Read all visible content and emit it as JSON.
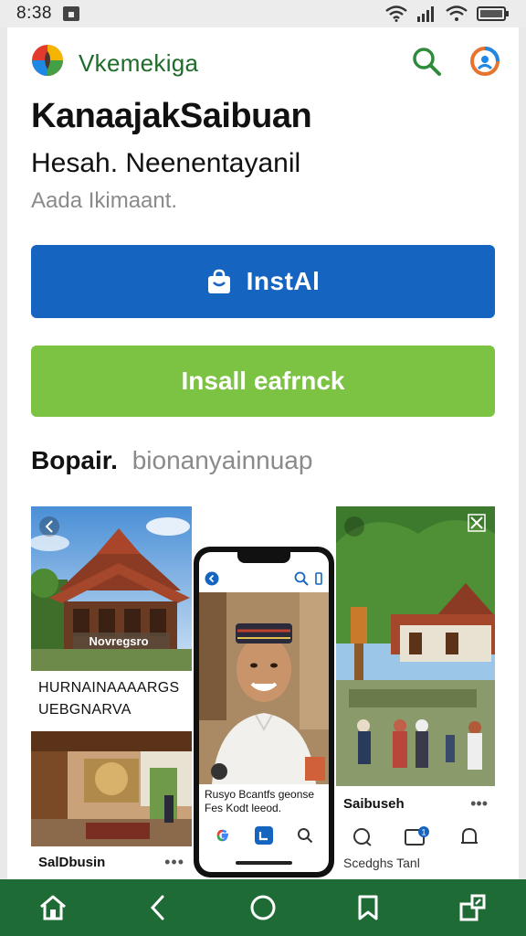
{
  "status_bar": {
    "time": "8:38"
  },
  "app_bar": {
    "app_name": "Vkemekiga"
  },
  "listing": {
    "title": "KanaajakSaibuan",
    "developer": "Hesah. Neenentayanil",
    "meta": "Aada Ikimaant."
  },
  "buttons": {
    "install_label": "InstAl",
    "secondary_label": "Insall eafrnck"
  },
  "section": {
    "label": "Bopair.",
    "hint": "bionanyainnuap"
  },
  "screenshots": {
    "left": {
      "banner_text": "Novregsro",
      "caption_line1": "HURNAINAAAARGS",
      "caption_line2": "UEBGNARVA",
      "footer_label": "SalDbusin",
      "footer_more": "•••"
    },
    "center": {
      "caption_line1": "Rusyo Bcantfs geonse",
      "caption_line2": "Fes Kodt leeod."
    },
    "right": {
      "footer_label": "Saibuseh",
      "footer_more": "•••",
      "caption": "Scedghs Tanl",
      "badge": "1"
    }
  },
  "colors": {
    "primary": "#1565c0",
    "secondary": "#7cc243",
    "brand_green": "#1e6b2a",
    "nav_bar": "#1e6b35"
  },
  "icons": [
    "home-icon",
    "wifi-icon",
    "signal-icon",
    "battery-icon",
    "search-icon",
    "profile-icon",
    "bag-icon",
    "back-icon",
    "circle-home-icon",
    "bookmark-icon",
    "share-icon"
  ]
}
